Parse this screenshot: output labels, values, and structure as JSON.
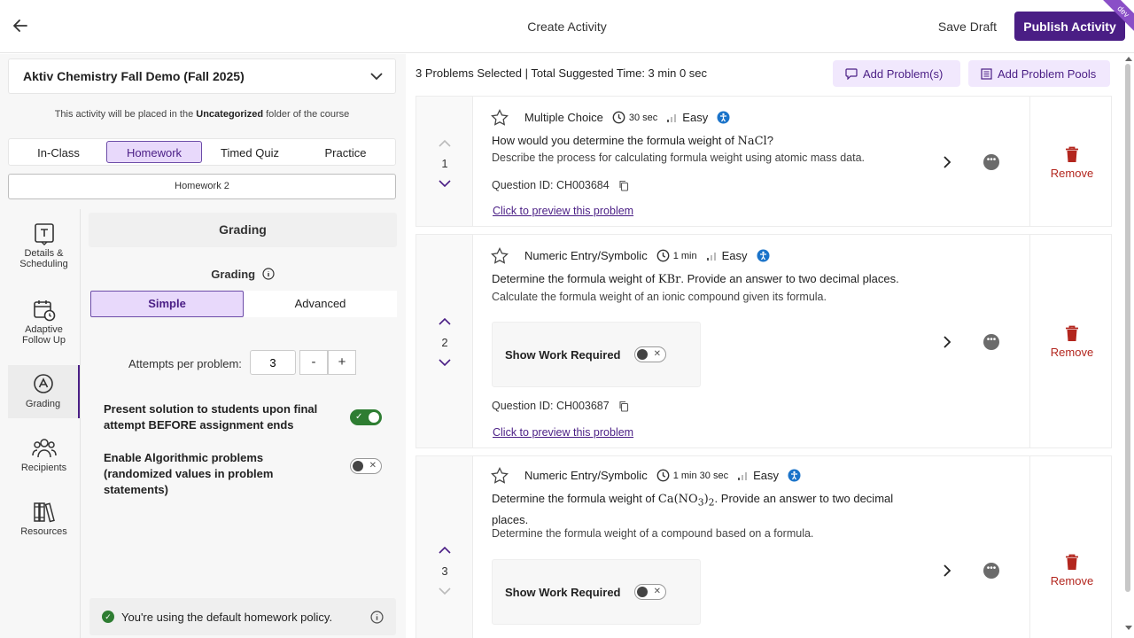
{
  "header": {
    "title": "Create Activity",
    "save_draft": "Save Draft",
    "publish": "Publish Activity",
    "env_badge": "dev"
  },
  "course": {
    "name": "Aktiv Chemistry Fall Demo (Fall 2025)"
  },
  "placement": {
    "prefix": "This activity will be placed in the ",
    "folder": "Uncategorized",
    "suffix": " folder of the course"
  },
  "activity_types": [
    "In-Class",
    "Homework",
    "Timed Quiz",
    "Practice"
  ],
  "activity_type_selected": "Homework",
  "activity_name": "Homework 2",
  "sidenav": [
    {
      "label_1": "Details &",
      "label_2": "Scheduling",
      "icon": "details-icon"
    },
    {
      "label_1": "Adaptive",
      "label_2": "Follow Up",
      "icon": "calendar-clock-icon"
    },
    {
      "label_1": "Grading",
      "label_2": "",
      "icon": "grading-icon"
    },
    {
      "label_1": "Recipients",
      "label_2": "",
      "icon": "people-icon"
    },
    {
      "label_1": "Resources",
      "label_2": "",
      "icon": "books-icon"
    }
  ],
  "grading": {
    "title": "Grading",
    "subtitle": "Grading",
    "modes": [
      "Simple",
      "Advanced"
    ],
    "mode_selected": "Simple",
    "attempts_label": "Attempts per problem:",
    "attempts_value": "3",
    "minus": "-",
    "plus": "+",
    "present_solution_label": "Present solution to students upon final attempt BEFORE assignment ends",
    "present_solution_on": true,
    "algorithmic_label": "Enable Algorithmic problems (randomized values in problem statements)",
    "algorithmic_on": false,
    "policy_note": "You're using the default homework policy."
  },
  "summary": "3 Problems Selected | Total Suggested Time: 3 min 0 sec",
  "add_problems": "Add Problem(s)",
  "add_problem_pools": "Add Problem Pools",
  "problems": [
    {
      "number": "1",
      "type": "Multiple Choice",
      "time": "30 sec",
      "difficulty": "Easy",
      "q_prefix": "How would you determine the formula weight of ",
      "q_math": "NaCl",
      "q_suffix": "?",
      "description": "Describe the process for calculating formula weight using atomic mass data.",
      "question_id": "Question ID: CH003684",
      "preview": "Click to preview this problem",
      "remove": "Remove"
    },
    {
      "number": "2",
      "type": "Numeric Entry/Symbolic",
      "time": "1 min",
      "difficulty": "Easy",
      "q_prefix": "Determine the formula weight of ",
      "q_math": "KBr",
      "q_suffix": ". Provide an answer to two decimal places.",
      "description": "Calculate the formula weight of an ionic compound given its formula.",
      "show_work": "Show Work Required",
      "question_id": "Question ID: CH003687",
      "preview": "Click to preview this problem",
      "remove": "Remove"
    },
    {
      "number": "3",
      "type": "Numeric Entry/Symbolic",
      "time": "1 min 30 sec",
      "difficulty": "Easy",
      "q_prefix": "Determine the formula weight of ",
      "q_math": "Ca(NO",
      "q_math_sub": "3",
      "q_math_close": ")",
      "q_math_sub2": "2",
      "q_suffix": ". Provide an answer to two decimal places.",
      "description": "Determine the formula weight of a compound based on a formula.",
      "show_work": "Show Work Required",
      "remove": "Remove"
    }
  ],
  "colors": {
    "brand": "#4a1e85",
    "accent_light": "#e8d9fb",
    "remove": "#b3261e",
    "toggle_on": "#2e7d32"
  }
}
